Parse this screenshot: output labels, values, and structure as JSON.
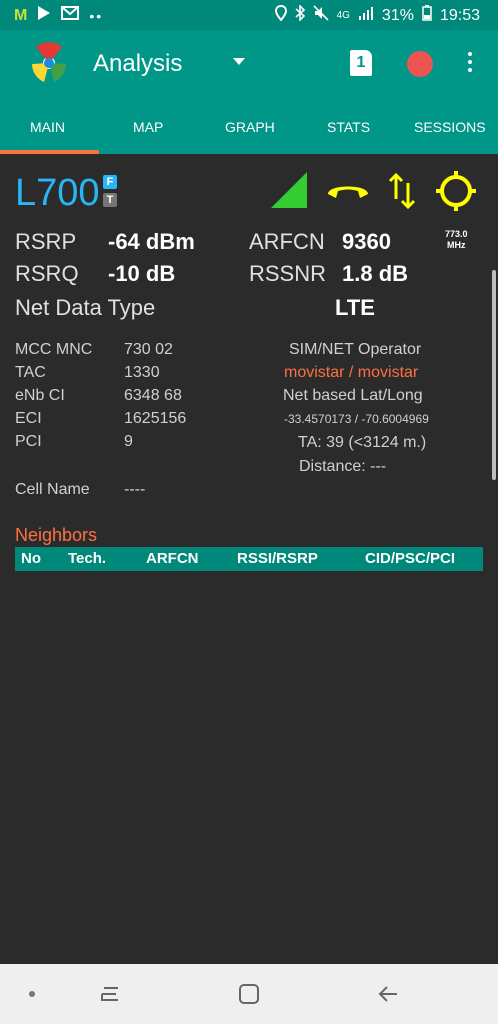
{
  "status": {
    "network": "4G",
    "battery": "31%",
    "time": "19:53"
  },
  "appbar": {
    "title": "Analysis",
    "sim_label": "1"
  },
  "tabs": [
    {
      "label": "MAIN",
      "active": true
    },
    {
      "label": "MAP"
    },
    {
      "label": "GRAPH"
    },
    {
      "label": "STATS"
    },
    {
      "label": "SESSIONS"
    }
  ],
  "cell": {
    "band": "L700",
    "badge_f": "F",
    "badge_t": "T",
    "frequency": "773.0",
    "frequency_unit": "MHz",
    "rsrp_label": "RSRP",
    "rsrp_value": "-64 dBm",
    "arfcn_label": "ARFCN",
    "arfcn_value": "9360",
    "rsrq_label": "RSRQ",
    "rsrq_value": "-10 dB",
    "rssnr_label": "RSSNR",
    "rssnr_value": "1.8 dB",
    "net_type_label": "Net Data Type",
    "net_type_value": "LTE"
  },
  "details": {
    "mcc_mnc_label": "MCC MNC",
    "mcc_mnc_value": "730 02",
    "tac_label": "TAC",
    "tac_value": "1330",
    "enb_label": "eNb CI",
    "enb_value": "6348 68",
    "eci_label": "ECI",
    "eci_value": "1625156",
    "pci_label": "PCI",
    "pci_value": "9",
    "cell_name_label": "Cell Name",
    "cell_name_value": "----"
  },
  "operator": {
    "label": "SIM/NET Operator",
    "value": "movistar / movistar",
    "latlong_label": "Net based Lat/Long",
    "latlong_value": "-33.4570173 / -70.6004969",
    "ta": "TA: 39 (<3124 m.)",
    "distance": "Distance: ---"
  },
  "neighbors": {
    "title": "Neighbors",
    "columns": [
      "No",
      "Tech.",
      "ARFCN",
      "RSSI/RSRP",
      "CID/PSC/PCI"
    ]
  },
  "colors": {
    "appbar": "#009688",
    "accent": "#ff7043",
    "band": "#29b6f6",
    "signal": "#33cc33",
    "icons": "#ffff00"
  }
}
